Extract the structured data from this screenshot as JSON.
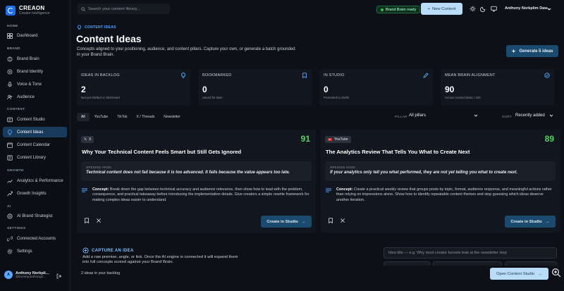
{
  "brand": {
    "name": "CREAON",
    "subtitle": "Creator Intelligence"
  },
  "sidebar": {
    "sections": [
      {
        "label": "HOME",
        "items": [
          {
            "label": "Dashboard",
            "icon": "grid-icon"
          }
        ]
      },
      {
        "label": "BRAND",
        "items": [
          {
            "label": "Brand Brain",
            "icon": "brain-icon"
          },
          {
            "label": "Brand Identity",
            "icon": "identity-icon"
          },
          {
            "label": "Voice & Tone",
            "icon": "mic-icon"
          },
          {
            "label": "Audience",
            "icon": "people-icon"
          }
        ]
      },
      {
        "label": "CONTENT",
        "items": [
          {
            "label": "Content Studio",
            "icon": "studio-icon"
          },
          {
            "label": "Content Ideas",
            "icon": "lightbulb-icon",
            "active": true
          },
          {
            "label": "Content Calendar",
            "icon": "calendar-icon"
          },
          {
            "label": "Content Library",
            "icon": "library-icon"
          }
        ]
      },
      {
        "label": "GROWTH",
        "items": [
          {
            "label": "Analytics & Performance",
            "icon": "analytics-icon"
          },
          {
            "label": "Growth Insights",
            "icon": "insights-icon"
          }
        ]
      },
      {
        "label": "AI",
        "items": [
          {
            "label": "AI Brand Strategist",
            "icon": "strategist-icon"
          }
        ]
      },
      {
        "label": "SETTINGS",
        "items": [
          {
            "label": "Connected Accounts",
            "icon": "link-icon"
          },
          {
            "label": "Settings",
            "icon": "gear-icon"
          }
        ]
      }
    ],
    "user": {
      "initials": "A",
      "name": "Anthony Norkpli...",
      "email": "@tommyanthonyp..."
    }
  },
  "topbar": {
    "search_placeholder": "Search your content library...",
    "status": "Brand Brain ready",
    "new_content": "New Content",
    "user": "Anthony Norkplim Daw..."
  },
  "page": {
    "eyebrow": "CONTENT IDEAS",
    "title": "Content Ideas",
    "description": "Concepts aligned to your positioning, audience, and content pillars. Capture your own, or generate a batch grounded in your Brand Brain.",
    "generate_button": "Generate 5 ideas"
  },
  "stats": [
    {
      "label": "IDEAS IN BACKLOG",
      "value": "2",
      "note": "Not yet drafted or dismissed",
      "icon": "lightbulb-icon"
    },
    {
      "label": "BOOKMARKED",
      "value": "0",
      "note": "Saved for later",
      "icon": "bookmark-icon"
    },
    {
      "label": "IN STUDIO",
      "value": "0",
      "note": "Promoted to drafts",
      "icon": "edit-icon"
    },
    {
      "label": "MEAN BRAIN ALIGNMENT",
      "value": "90",
      "note": "Across scored ideas / 100",
      "icon": "check-circle-icon"
    }
  ],
  "filters": {
    "chips": [
      "All",
      "YouTube",
      "TikTok",
      "X / Threads",
      "Newsletter"
    ],
    "pillar_label": "PILLAR",
    "pillar_value": "All pillars",
    "sort_label": "SORT",
    "sort_value": "Recently added"
  },
  "cards": [
    {
      "platform": "X",
      "score": "91",
      "title": "Why Your Technical Content Feels Smart but Still Gets Ignored",
      "hook_label": "OPENING HOOK",
      "hook": "Technical content does not fail because it is too advanced. It fails because the value appears too late.",
      "concept_lead": "Concept:",
      "concept": "Break down the gap between technical accuracy and audience relevance, then show how to lead with the problem, consequence, and practical takeaway before introducing the implementation details. Give creators a simple rewrite framework for making complex ideas easier to understand.",
      "cta": "Create in Studio"
    },
    {
      "platform": "YouTube",
      "score": "89",
      "title": "The Analytics Review That Tells You What to Create Next",
      "hook_label": "OPENING HOOK",
      "hook": "If your analytics only tell you what performed, they are not yet telling you what to create next.",
      "concept_lead": "Concept:",
      "concept": "Create a practical weekly review that groups posts by topic, format, audience response, and meaningful actions rather than relying on impressions alone. Show how to identify repeatable content themes and stop guessing which ideas deserve another iteration.",
      "cta": "Create in Studio"
    }
  ],
  "capture": {
    "title": "CAPTURE AN IDEA",
    "description": "Add a raw premise, angle, or link. Once the AI engine is connected it will expand them into full concepts scored against your Brand Brain.",
    "input_placeholder": "Idea title — e.g. Why most creator funnels leak at the newsletter step"
  },
  "footer": {
    "backlog_count": "2 ideas in your backlog",
    "open_studio": "Open Content Studio"
  },
  "colors": {
    "accent": "#58a6ff",
    "score": "#56d364",
    "active_nav": "#1a3a5c",
    "primary_button": "#b9dcf7"
  }
}
